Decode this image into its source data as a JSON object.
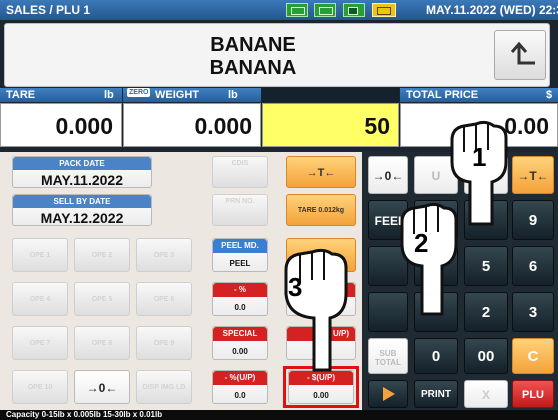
{
  "header": {
    "title": "SALES / PLU 1",
    "date": "MAY.11.2022 (WED)  22:3",
    "indicators": [
      "status-indicator-1",
      "status-indicator-2",
      "battery-icon",
      "plug-icon"
    ]
  },
  "item": {
    "name_line1": "BANANE",
    "name_line2": "BANANA"
  },
  "weights": {
    "tare_label": "TARE",
    "tare_unit": "lb",
    "tare_value": "0.000",
    "zero_badge": "ZERO",
    "weight_label": "WEIGHT",
    "weight_unit": "lb",
    "weight_value": "0.000",
    "unit_price_value": "50",
    "total_label": "TOTAL PRICE",
    "total_unit": "$",
    "total_value": "0.00"
  },
  "left_panel": {
    "pack_date_label": "PACK DATE",
    "pack_date_value": "MAY.11.2022",
    "sell_date_label": "SELL BY DATE",
    "sell_date_value": "MAY.12.2022",
    "cdis": "CDIS",
    "prn_no": "PRN NO.",
    "ope": [
      "OPE 1",
      "OPE 2",
      "OPE 3",
      "OPE 4",
      "OPE 5",
      "OPE 6",
      "OPE 7",
      "OPE 8",
      "OPE 9",
      "OPE 10"
    ],
    "zero_btn": "→0←",
    "disp_img": "DISP IMG LD",
    "tare_btn": "→T←",
    "tare_fixed": "TARE 0.012kg",
    "tare_fixed2": "0.018kg",
    "peel_md_label": "PEEL MD.",
    "peel_md_value": "PEEL",
    "pct_label": "- %",
    "pct_value": "0.0",
    "special_label": "SPECIAL",
    "special_value": "0.00",
    "pct_up_label": "- %(U/P)",
    "pct_up_value": "0.0",
    "dollar_up_label": "- $(U/P)",
    "dollar_up_value": "0.00",
    "up_partial": "U/P)"
  },
  "keypad": {
    "zero_btn": "→0←",
    "u_partial": "U",
    "tare_btn": "→T←",
    "feed": "FEEI",
    "k9": "9",
    "k5": "5",
    "k6": "6",
    "k2": "2",
    "k3": "3",
    "sub_total": "SUB TOTAL",
    "k0": "0",
    "k00": "00",
    "clear": "C",
    "print": "PRINT",
    "x": "X",
    "plu": "PLU"
  },
  "footer": {
    "capacity": "Capacity 0-15lb x 0.005lb  15-30lb x 0.01lb"
  },
  "callouts": [
    "1",
    "2",
    "3"
  ],
  "colors": {
    "accent_blue": "#2f6aa8",
    "highlight": "#ffff66",
    "orange": "#f4a23a",
    "red": "#d42222"
  }
}
